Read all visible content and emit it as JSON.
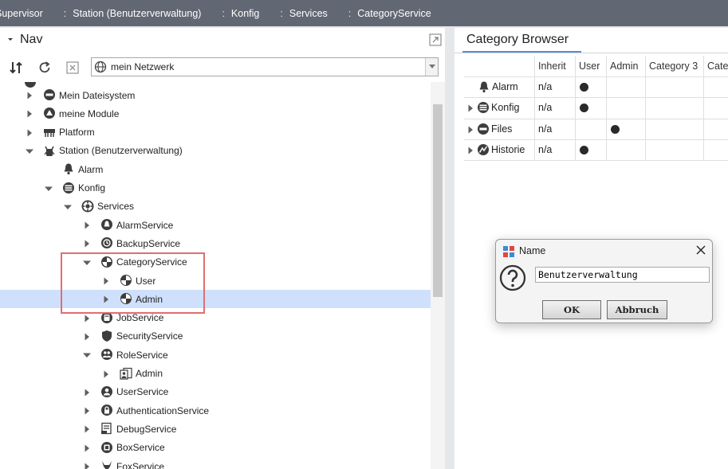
{
  "breadcrumb": [
    {
      "label": "Supervisor"
    },
    {
      "label": "Station (Benutzerverwaltung)"
    },
    {
      "label": "Konfig"
    },
    {
      "label": "Services"
    },
    {
      "label": "CategoryService"
    }
  ],
  "nav": {
    "title": "Nav",
    "combo_value": "mein Netzwerk",
    "tree": [
      {
        "label": "Mein Dateisystem",
        "icon": "drive-icon",
        "expand": "collapsed"
      },
      {
        "label": "meine Module",
        "icon": "module-icon",
        "expand": "collapsed"
      },
      {
        "label": "Platform",
        "icon": "platform-icon",
        "expand": "collapsed"
      },
      {
        "label": "Station (Benutzerverwaltung)",
        "icon": "station-icon",
        "expand": "expanded"
      },
      {
        "label": "Alarm",
        "icon": "bell-icon",
        "expand": "none"
      },
      {
        "label": "Konfig",
        "icon": "database-icon",
        "expand": "expanded"
      },
      {
        "label": "Services",
        "icon": "services-icon",
        "expand": "expanded"
      },
      {
        "label": "AlarmService",
        "icon": "alarm-service-icon",
        "expand": "collapsed"
      },
      {
        "label": "BackupService",
        "icon": "backup-icon",
        "expand": "collapsed"
      },
      {
        "label": "CategoryService",
        "icon": "category-service-icon",
        "expand": "expanded"
      },
      {
        "label": "User",
        "icon": "category-icon",
        "expand": "collapsed"
      },
      {
        "label": "Admin",
        "icon": "category-icon",
        "expand": "collapsed",
        "selected": true
      },
      {
        "label": "JobService",
        "icon": "job-icon",
        "expand": "collapsed"
      },
      {
        "label": "SecurityService",
        "icon": "shield-icon",
        "expand": "collapsed"
      },
      {
        "label": "RoleService",
        "icon": "role-service-icon",
        "expand": "expanded"
      },
      {
        "label": "Admin",
        "icon": "role-icon",
        "expand": "collapsed"
      },
      {
        "label": "UserService",
        "icon": "user-service-icon",
        "expand": "collapsed"
      },
      {
        "label": "AuthenticationService",
        "icon": "lock-icon",
        "expand": "collapsed"
      },
      {
        "label": "DebugService",
        "icon": "debug-icon",
        "expand": "collapsed"
      },
      {
        "label": "BoxService",
        "icon": "box-icon",
        "expand": "collapsed"
      },
      {
        "label": "FoxService",
        "icon": "fox-icon",
        "expand": "collapsed"
      }
    ]
  },
  "category_browser": {
    "tab_label": "Category Browser",
    "columns": [
      "Inherit",
      "User",
      "Admin",
      "Category 3",
      "Categ"
    ],
    "rows": [
      {
        "label": "Alarm",
        "icon": "bell-icon",
        "inherit": "n/a",
        "marks": [
          true,
          false,
          false,
          false
        ],
        "expandable": false
      },
      {
        "label": "Konfig",
        "icon": "database-icon",
        "inherit": "n/a",
        "marks": [
          true,
          false,
          false,
          false
        ],
        "expandable": true
      },
      {
        "label": "Files",
        "icon": "drive-icon",
        "inherit": "n/a",
        "marks": [
          false,
          true,
          false,
          false
        ],
        "expandable": true
      },
      {
        "label": "Historie",
        "icon": "history-icon",
        "inherit": "n/a",
        "marks": [
          true,
          false,
          false,
          false
        ],
        "expandable": true
      }
    ]
  },
  "dialog": {
    "title": "Name",
    "input_value": "Benutzerverwaltung",
    "ok_label": "OK",
    "cancel_label": "Abbruch"
  },
  "colors": {
    "breadcrumb_bg": "#616873",
    "selection": "#cfe0fc",
    "highlight_border": "#e06e70"
  }
}
